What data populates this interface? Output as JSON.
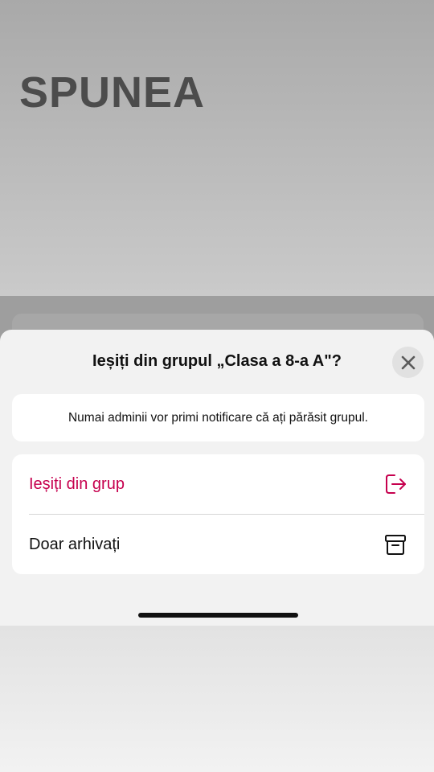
{
  "background": {
    "app_title": "SPUNEA"
  },
  "dialog": {
    "title": "Ieșiți din grupul „Clasa a 8-a A\"?",
    "notice": "Numai adminii vor primi notificare că ați părăsit grupul.",
    "actions": [
      {
        "label": "Ieșiți din grup",
        "icon": "exit-icon",
        "color": "#c6004e"
      },
      {
        "label": "Doar arhivați",
        "icon": "archive-icon",
        "color": "#111111"
      }
    ],
    "close_icon": "close-icon"
  }
}
